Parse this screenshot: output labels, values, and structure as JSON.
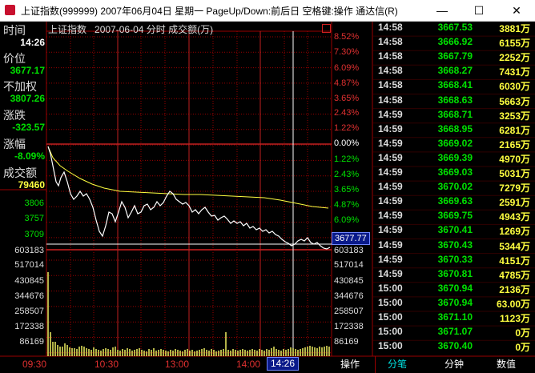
{
  "window": {
    "title": "上证指数(999999) 2007年06月04日 星期一 PageUp/Down:前后日 空格键:操作 通达信(R)",
    "min": "—",
    "max": "☐",
    "close": "✕"
  },
  "chart_header": {
    "index_name": "上证指数",
    "date": "2007-06-04",
    "mode": "分时",
    "volume_unit": "成交额(万)"
  },
  "info_panel": [
    {
      "label": "时间",
      "value": "14:26"
    },
    {
      "label": "价位",
      "value": "3677.17"
    },
    {
      "label": "不加权",
      "value": "3807.26"
    },
    {
      "label": "涨跌",
      "value": "-323.57"
    },
    {
      "label": "涨幅",
      "value": "-8.09%"
    },
    {
      "label": "成交额",
      "value": "79460"
    }
  ],
  "price_axis_left": [
    "3806",
    "3757",
    "3709"
  ],
  "pct_axis": {
    "up": [
      "8.52%",
      "7.30%",
      "6.09%",
      "4.87%",
      "3.65%",
      "2.43%",
      "1.22%"
    ],
    "zero": "0.00%",
    "down": [
      "1.22%",
      "2.43%",
      "3.65%",
      "4.87%",
      "6.09%"
    ]
  },
  "cursor_price_tag": "3677.77",
  "volume_axis": [
    "603183",
    "517014",
    "430845",
    "344676",
    "258507",
    "172338",
    "86169"
  ],
  "time_axis": [
    "09:30",
    "10:30",
    "13:00",
    "14:00"
  ],
  "cursor_time": "14:26",
  "colors": {
    "up_red": "#e03030",
    "down_green": "#00e000",
    "price_line": "#ffffff",
    "avg_line": "#ffff40",
    "grid_red": "#9a0000",
    "volume_yellow": "#ffff66"
  },
  "trades": [
    {
      "time": "14:58",
      "price": "3667.53",
      "amount": "3881万"
    },
    {
      "time": "14:58",
      "price": "3666.92",
      "amount": "6155万"
    },
    {
      "time": "14:58",
      "price": "3667.79",
      "amount": "2252万"
    },
    {
      "time": "14:58",
      "price": "3668.27",
      "amount": "7431万"
    },
    {
      "time": "14:58",
      "price": "3668.41",
      "amount": "6030万"
    },
    {
      "time": "14:58",
      "price": "3668.63",
      "amount": "5663万"
    },
    {
      "time": "14:59",
      "price": "3668.71",
      "amount": "3253万"
    },
    {
      "time": "14:59",
      "price": "3668.95",
      "amount": "6281万"
    },
    {
      "time": "14:59",
      "price": "3669.02",
      "amount": "2165万"
    },
    {
      "time": "14:59",
      "price": "3669.39",
      "amount": "4970万"
    },
    {
      "time": "14:59",
      "price": "3669.03",
      "amount": "5031万"
    },
    {
      "time": "14:59",
      "price": "3670.02",
      "amount": "7279万"
    },
    {
      "time": "14:59",
      "price": "3669.63",
      "amount": "2591万"
    },
    {
      "time": "14:59",
      "price": "3669.75",
      "amount": "4943万"
    },
    {
      "time": "14:59",
      "price": "3670.41",
      "amount": "1269万"
    },
    {
      "time": "14:59",
      "price": "3670.43",
      "amount": "5344万"
    },
    {
      "time": "14:59",
      "price": "3670.33",
      "amount": "4151万"
    },
    {
      "time": "14:59",
      "price": "3670.81",
      "amount": "4785万"
    },
    {
      "time": "15:00",
      "price": "3670.94",
      "amount": "2136万"
    },
    {
      "time": "15:00",
      "price": "3670.94",
      "amount": "63.00万"
    },
    {
      "time": "15:00",
      "price": "3671.10",
      "amount": "1123万"
    },
    {
      "time": "15:00",
      "price": "3671.07",
      "amount": "0万"
    },
    {
      "time": "15:00",
      "price": "3670.40",
      "amount": "0万"
    }
  ],
  "bottom_tabs": [
    "操作",
    "分笔",
    "分钟",
    "数值"
  ]
}
